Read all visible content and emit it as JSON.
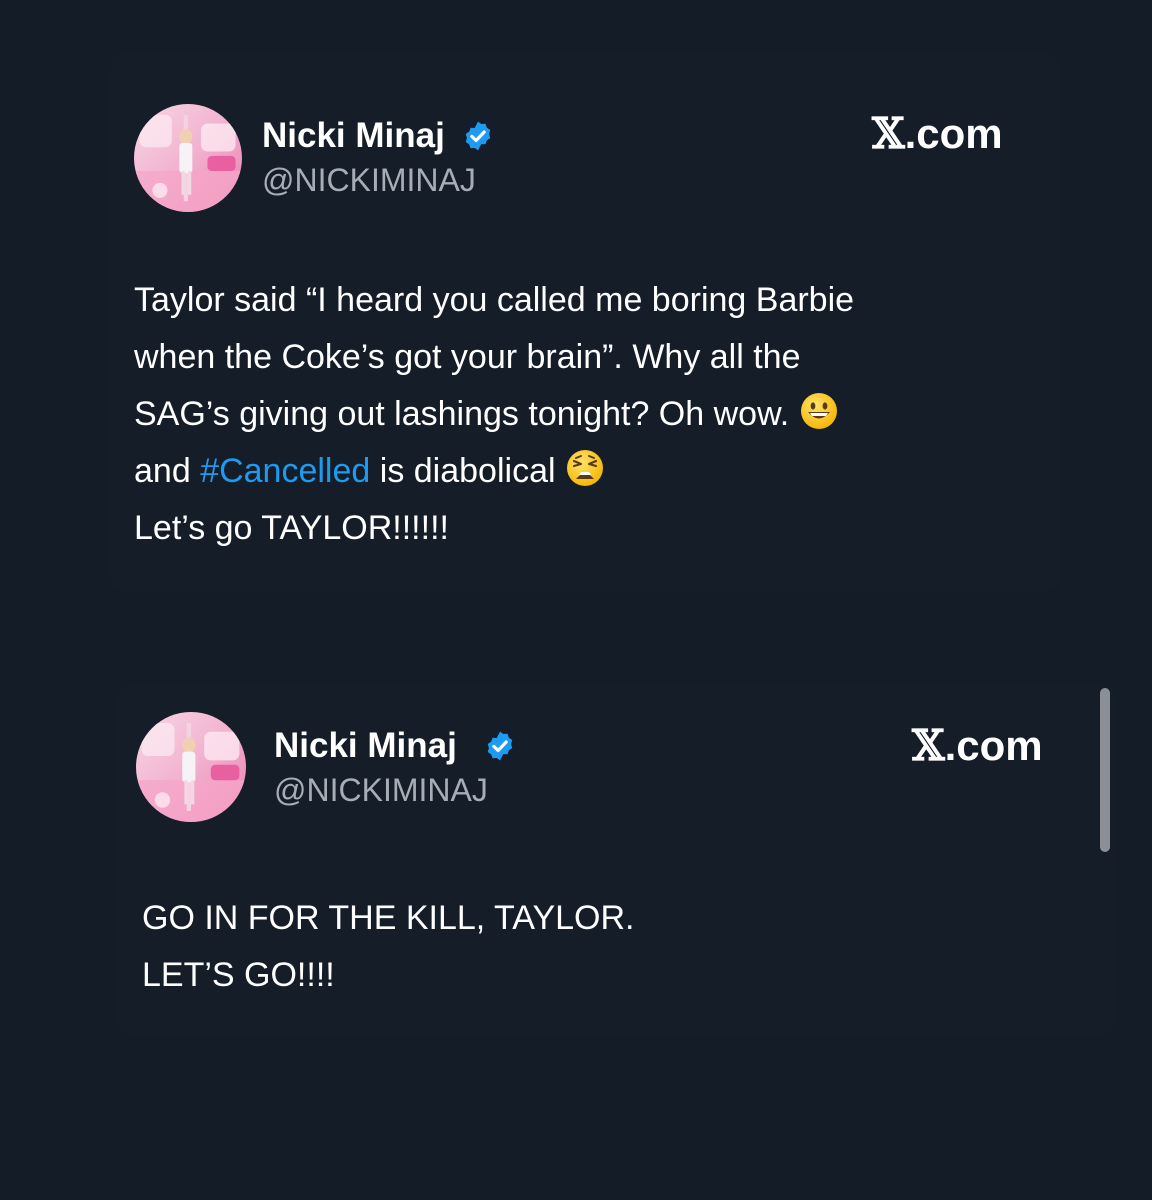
{
  "tweets": [
    {
      "author": {
        "name": "Nicki Minaj",
        "handle": "@NICKIMINAJ",
        "verified_icon": "verified-badge-icon",
        "verified_color": "#1d9bf0"
      },
      "brand": {
        "x_symbol": "𝕏",
        "domain": ".com"
      },
      "text": {
        "line1": "Taylor said “I heard you called me boring Barbie",
        "line2": "when the Coke’s got your brain”. Why all the",
        "line3_prefix": "SAG’s giving out lashings tonight? Oh wow.",
        "line3_emoji": "grinning-face-emoji",
        "line4_prefix": "and",
        "line4_hashtag": "#Cancelled",
        "line4_suffix": "is diabolical",
        "line4_emoji": "weary-face-emoji",
        "line5": "Let’s go TAYLOR!!!!!!"
      }
    },
    {
      "author": {
        "name": "Nicki Minaj",
        "handle": "@NICKIMINAJ",
        "verified_icon": "verified-badge-icon",
        "verified_color": "#1d9bf0"
      },
      "brand": {
        "x_symbol": "𝕏",
        "domain": ".com"
      },
      "text": {
        "line1": "GO IN FOR THE KILL, TAYLOR.",
        "line2": "LET’S GO!!!!"
      }
    }
  ],
  "colors": {
    "background": "#141c27",
    "hashtag": "#1d9bf0",
    "handle": "#a7adb6"
  }
}
